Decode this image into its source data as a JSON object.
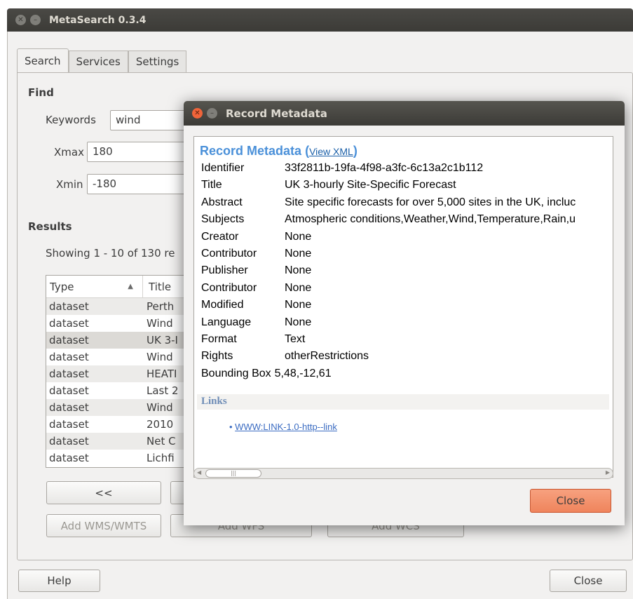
{
  "main_window": {
    "title": "MetaSearch 0.3.4",
    "tabs": [
      {
        "label": "Search"
      },
      {
        "label": "Services"
      },
      {
        "label": "Settings"
      }
    ],
    "find": {
      "heading": "Find",
      "keywords_label": "Keywords",
      "keywords_value": "wind",
      "xmax_label": "Xmax",
      "xmax_value": "180",
      "xmin_label": "Xmin",
      "xmin_value": "-180"
    },
    "results": {
      "heading": "Results",
      "showing_text": "Showing 1 - 10 of 130 re",
      "columns": [
        "Type",
        "Title"
      ],
      "rows": [
        {
          "type": "dataset",
          "title": "Perth"
        },
        {
          "type": "dataset",
          "title": "Wind"
        },
        {
          "type": "dataset",
          "title": "UK 3-I"
        },
        {
          "type": "dataset",
          "title": "Wind"
        },
        {
          "type": "dataset",
          "title": "HEATI"
        },
        {
          "type": "dataset",
          "title": "Last 2"
        },
        {
          "type": "dataset",
          "title": "Wind"
        },
        {
          "type": "dataset",
          "title": "2010"
        },
        {
          "type": "dataset",
          "title": "Net C"
        },
        {
          "type": "dataset",
          "title": "Lichfi"
        }
      ],
      "selected_row_index": 2
    },
    "buttons": {
      "prev": "<<",
      "add_wms": "Add WMS/WMTS",
      "add_wfs": "Add WFS",
      "add_wcs": "Add WCS",
      "help": "Help",
      "close": "Close"
    }
  },
  "dialog": {
    "title": "Record Metadata",
    "heading": "Record Metadata",
    "paren_open": "(",
    "view_xml": "View XML",
    "paren_close": ")",
    "fields": [
      {
        "key": "Identifier",
        "value": "33f2811b-19fa-4f98-a3fc-6c13a2c1b112"
      },
      {
        "key": "Title",
        "value": "UK 3-hourly Site-Specific Forecast"
      },
      {
        "key": "Abstract",
        "value": "Site specific forecasts for over 5,000 sites in the UK, incluc"
      },
      {
        "key": "Subjects",
        "value": "Atmospheric conditions,Weather,Wind,Temperature,Rain,u"
      },
      {
        "key": "Creator",
        "value": "None"
      },
      {
        "key": "Contributor",
        "value": "None"
      },
      {
        "key": "Publisher",
        "value": "None"
      },
      {
        "key": "Contributor",
        "value": "None"
      },
      {
        "key": "Modified",
        "value": "None"
      },
      {
        "key": "Language",
        "value": "None"
      },
      {
        "key": "Format",
        "value": "Text"
      },
      {
        "key": "Rights",
        "value": "otherRestrictions"
      },
      {
        "key": "Bounding Box",
        "value": "5,48,-12,61"
      }
    ],
    "links_heading": "Links",
    "link_text": "WWW:LINK-1.0-http--link",
    "close_button": "Close"
  }
}
